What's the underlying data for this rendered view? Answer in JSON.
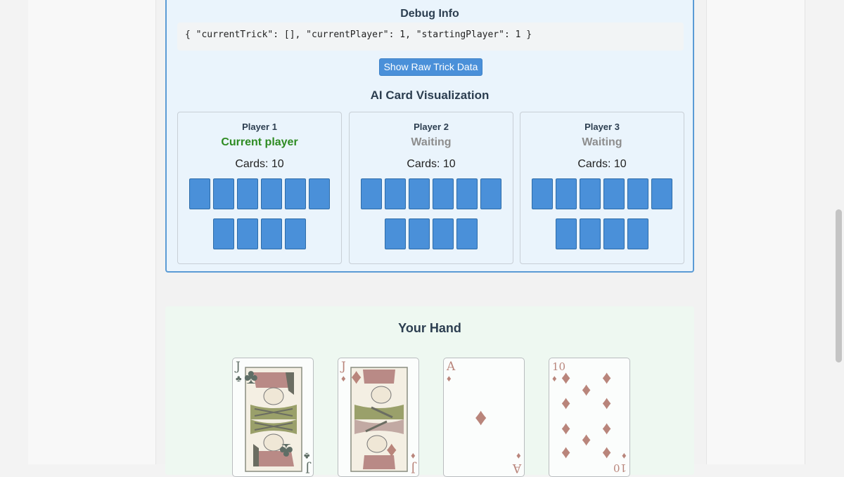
{
  "debug": {
    "title": "Debug Info",
    "json_text": "{ \"currentTrick\": [], \"currentPlayer\": 1, \"startingPlayer\": 1 }",
    "raw_button_label": "Show Raw Trick Data",
    "viz_title": "AI Card Visualization"
  },
  "players": [
    {
      "name": "Player 1",
      "status": "Current player",
      "cards_label": "Cards: 10",
      "card_count": 10
    },
    {
      "name": "Player 2",
      "status": "Waiting",
      "cards_label": "Cards: 10",
      "card_count": 10
    },
    {
      "name": "Player 3",
      "status": "Waiting",
      "cards_label": "Cards: 10",
      "card_count": 10
    }
  ],
  "hand": {
    "title": "Your Hand",
    "cards": [
      {
        "rank": "J",
        "suit": "♣",
        "suit_name": "clubs",
        "color": "#5f6e66"
      },
      {
        "rank": "J",
        "suit": "♦",
        "suit_name": "diamonds",
        "color": "#b9857b"
      },
      {
        "rank": "A",
        "suit": "♦",
        "suit_name": "diamonds",
        "color": "#b9857b"
      },
      {
        "rank": "10",
        "suit": "♦",
        "suit_name": "diamonds",
        "color": "#b9857b"
      }
    ]
  },
  "colors": {
    "accent_blue": "#4a90d9",
    "active_green": "#2e8b22",
    "waiting_gray": "#8d8d8d"
  }
}
